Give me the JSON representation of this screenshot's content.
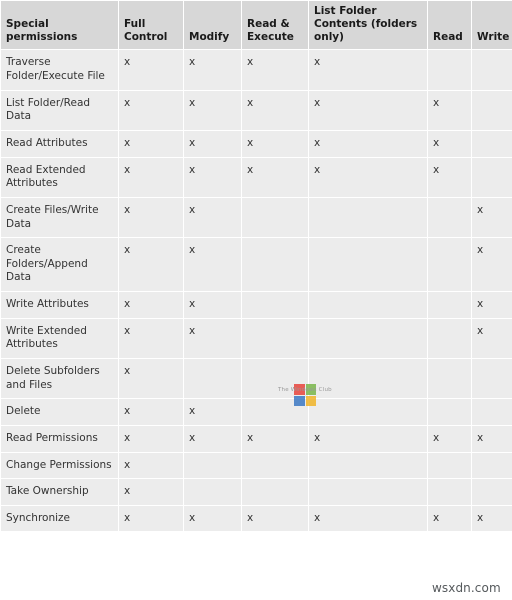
{
  "table": {
    "columns": [
      {
        "id": "special_permissions",
        "label": "Special permissions"
      },
      {
        "id": "full_control",
        "label": "Full Control"
      },
      {
        "id": "modify",
        "label": "Modify"
      },
      {
        "id": "read_execute",
        "label": "Read & Execute"
      },
      {
        "id": "list_folder_contents",
        "label": "List Folder Contents (folders only)"
      },
      {
        "id": "read",
        "label": "Read"
      },
      {
        "id": "write",
        "label": "Write"
      }
    ],
    "mark": "x",
    "rows": [
      {
        "label": "Traverse Folder/Execute File",
        "marks": [
          "x",
          "x",
          "x",
          "x",
          "",
          ""
        ]
      },
      {
        "label": "List Folder/Read Data",
        "marks": [
          "x",
          "x",
          "x",
          "x",
          "x",
          ""
        ]
      },
      {
        "label": "Read Attributes",
        "marks": [
          "x",
          "x",
          "x",
          "x",
          "x",
          ""
        ]
      },
      {
        "label": "Read Extended Attributes",
        "marks": [
          "x",
          "x",
          "x",
          "x",
          "x",
          ""
        ]
      },
      {
        "label": "Create Files/Write Data",
        "marks": [
          "x",
          "x",
          "",
          "",
          "",
          "x"
        ]
      },
      {
        "label": "Create Folders/Append Data",
        "marks": [
          "x",
          "x",
          "",
          "",
          "",
          "x"
        ]
      },
      {
        "label": "Write Attributes",
        "marks": [
          "x",
          "x",
          "",
          "",
          "",
          "x"
        ]
      },
      {
        "label": "Write Extended Attributes",
        "marks": [
          "x",
          "x",
          "",
          "",
          "",
          "x"
        ]
      },
      {
        "label": "Delete Subfolders and Files",
        "marks": [
          "x",
          "",
          "",
          "",
          "",
          ""
        ]
      },
      {
        "label": "Delete",
        "marks": [
          "x",
          "x",
          "",
          "",
          "",
          ""
        ]
      },
      {
        "label": "Read Permissions",
        "marks": [
          "x",
          "x",
          "x",
          "x",
          "x",
          "x"
        ]
      },
      {
        "label": "Change Permissions",
        "marks": [
          "x",
          "",
          "",
          "",
          "",
          ""
        ]
      },
      {
        "label": "Take Ownership",
        "marks": [
          "x",
          "",
          "",
          "",
          "",
          ""
        ]
      },
      {
        "label": "Synchronize",
        "marks": [
          "x",
          "x",
          "x",
          "x",
          "x",
          "x"
        ]
      }
    ]
  },
  "watermarks": {
    "windows_club": "The Windows Club",
    "site": "wsxdn.com"
  },
  "colors": {
    "header_background": "#d7d7d7",
    "cell_background": "#ececec",
    "page_background": "#ffffff",
    "header_text": "#1a1a1a",
    "cell_text": "#333333",
    "logo_red": "#e8453c",
    "logo_green": "#7ab64a",
    "logo_blue": "#3b78c4",
    "logo_yellow": "#f0b429",
    "site_watermark_text": "#55595c"
  }
}
